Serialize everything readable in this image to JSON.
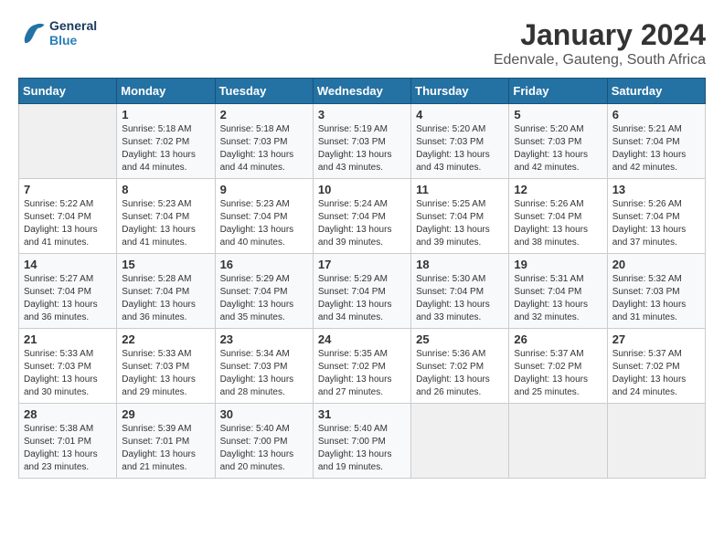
{
  "header": {
    "logo_line1": "General",
    "logo_line2": "Blue",
    "title": "January 2024",
    "subtitle": "Edenvale, Gauteng, South Africa"
  },
  "days_of_week": [
    "Sunday",
    "Monday",
    "Tuesday",
    "Wednesday",
    "Thursday",
    "Friday",
    "Saturday"
  ],
  "weeks": [
    [
      {
        "day": "",
        "sunrise": "",
        "sunset": "",
        "daylight": "",
        "empty": true
      },
      {
        "day": "1",
        "sunrise": "Sunrise: 5:18 AM",
        "sunset": "Sunset: 7:02 PM",
        "daylight": "Daylight: 13 hours and 44 minutes."
      },
      {
        "day": "2",
        "sunrise": "Sunrise: 5:18 AM",
        "sunset": "Sunset: 7:03 PM",
        "daylight": "Daylight: 13 hours and 44 minutes."
      },
      {
        "day": "3",
        "sunrise": "Sunrise: 5:19 AM",
        "sunset": "Sunset: 7:03 PM",
        "daylight": "Daylight: 13 hours and 43 minutes."
      },
      {
        "day": "4",
        "sunrise": "Sunrise: 5:20 AM",
        "sunset": "Sunset: 7:03 PM",
        "daylight": "Daylight: 13 hours and 43 minutes."
      },
      {
        "day": "5",
        "sunrise": "Sunrise: 5:20 AM",
        "sunset": "Sunset: 7:03 PM",
        "daylight": "Daylight: 13 hours and 42 minutes."
      },
      {
        "day": "6",
        "sunrise": "Sunrise: 5:21 AM",
        "sunset": "Sunset: 7:04 PM",
        "daylight": "Daylight: 13 hours and 42 minutes."
      }
    ],
    [
      {
        "day": "7",
        "sunrise": "Sunrise: 5:22 AM",
        "sunset": "Sunset: 7:04 PM",
        "daylight": "Daylight: 13 hours and 41 minutes."
      },
      {
        "day": "8",
        "sunrise": "Sunrise: 5:23 AM",
        "sunset": "Sunset: 7:04 PM",
        "daylight": "Daylight: 13 hours and 41 minutes."
      },
      {
        "day": "9",
        "sunrise": "Sunrise: 5:23 AM",
        "sunset": "Sunset: 7:04 PM",
        "daylight": "Daylight: 13 hours and 40 minutes."
      },
      {
        "day": "10",
        "sunrise": "Sunrise: 5:24 AM",
        "sunset": "Sunset: 7:04 PM",
        "daylight": "Daylight: 13 hours and 39 minutes."
      },
      {
        "day": "11",
        "sunrise": "Sunrise: 5:25 AM",
        "sunset": "Sunset: 7:04 PM",
        "daylight": "Daylight: 13 hours and 39 minutes."
      },
      {
        "day": "12",
        "sunrise": "Sunrise: 5:26 AM",
        "sunset": "Sunset: 7:04 PM",
        "daylight": "Daylight: 13 hours and 38 minutes."
      },
      {
        "day": "13",
        "sunrise": "Sunrise: 5:26 AM",
        "sunset": "Sunset: 7:04 PM",
        "daylight": "Daylight: 13 hours and 37 minutes."
      }
    ],
    [
      {
        "day": "14",
        "sunrise": "Sunrise: 5:27 AM",
        "sunset": "Sunset: 7:04 PM",
        "daylight": "Daylight: 13 hours and 36 minutes."
      },
      {
        "day": "15",
        "sunrise": "Sunrise: 5:28 AM",
        "sunset": "Sunset: 7:04 PM",
        "daylight": "Daylight: 13 hours and 36 minutes."
      },
      {
        "day": "16",
        "sunrise": "Sunrise: 5:29 AM",
        "sunset": "Sunset: 7:04 PM",
        "daylight": "Daylight: 13 hours and 35 minutes."
      },
      {
        "day": "17",
        "sunrise": "Sunrise: 5:29 AM",
        "sunset": "Sunset: 7:04 PM",
        "daylight": "Daylight: 13 hours and 34 minutes."
      },
      {
        "day": "18",
        "sunrise": "Sunrise: 5:30 AM",
        "sunset": "Sunset: 7:04 PM",
        "daylight": "Daylight: 13 hours and 33 minutes."
      },
      {
        "day": "19",
        "sunrise": "Sunrise: 5:31 AM",
        "sunset": "Sunset: 7:04 PM",
        "daylight": "Daylight: 13 hours and 32 minutes."
      },
      {
        "day": "20",
        "sunrise": "Sunrise: 5:32 AM",
        "sunset": "Sunset: 7:03 PM",
        "daylight": "Daylight: 13 hours and 31 minutes."
      }
    ],
    [
      {
        "day": "21",
        "sunrise": "Sunrise: 5:33 AM",
        "sunset": "Sunset: 7:03 PM",
        "daylight": "Daylight: 13 hours and 30 minutes."
      },
      {
        "day": "22",
        "sunrise": "Sunrise: 5:33 AM",
        "sunset": "Sunset: 7:03 PM",
        "daylight": "Daylight: 13 hours and 29 minutes."
      },
      {
        "day": "23",
        "sunrise": "Sunrise: 5:34 AM",
        "sunset": "Sunset: 7:03 PM",
        "daylight": "Daylight: 13 hours and 28 minutes."
      },
      {
        "day": "24",
        "sunrise": "Sunrise: 5:35 AM",
        "sunset": "Sunset: 7:02 PM",
        "daylight": "Daylight: 13 hours and 27 minutes."
      },
      {
        "day": "25",
        "sunrise": "Sunrise: 5:36 AM",
        "sunset": "Sunset: 7:02 PM",
        "daylight": "Daylight: 13 hours and 26 minutes."
      },
      {
        "day": "26",
        "sunrise": "Sunrise: 5:37 AM",
        "sunset": "Sunset: 7:02 PM",
        "daylight": "Daylight: 13 hours and 25 minutes."
      },
      {
        "day": "27",
        "sunrise": "Sunrise: 5:37 AM",
        "sunset": "Sunset: 7:02 PM",
        "daylight": "Daylight: 13 hours and 24 minutes."
      }
    ],
    [
      {
        "day": "28",
        "sunrise": "Sunrise: 5:38 AM",
        "sunset": "Sunset: 7:01 PM",
        "daylight": "Daylight: 13 hours and 23 minutes."
      },
      {
        "day": "29",
        "sunrise": "Sunrise: 5:39 AM",
        "sunset": "Sunset: 7:01 PM",
        "daylight": "Daylight: 13 hours and 21 minutes."
      },
      {
        "day": "30",
        "sunrise": "Sunrise: 5:40 AM",
        "sunset": "Sunset: 7:00 PM",
        "daylight": "Daylight: 13 hours and 20 minutes."
      },
      {
        "day": "31",
        "sunrise": "Sunrise: 5:40 AM",
        "sunset": "Sunset: 7:00 PM",
        "daylight": "Daylight: 13 hours and 19 minutes."
      },
      {
        "day": "",
        "sunrise": "",
        "sunset": "",
        "daylight": "",
        "empty": true
      },
      {
        "day": "",
        "sunrise": "",
        "sunset": "",
        "daylight": "",
        "empty": true
      },
      {
        "day": "",
        "sunrise": "",
        "sunset": "",
        "daylight": "",
        "empty": true
      }
    ]
  ]
}
